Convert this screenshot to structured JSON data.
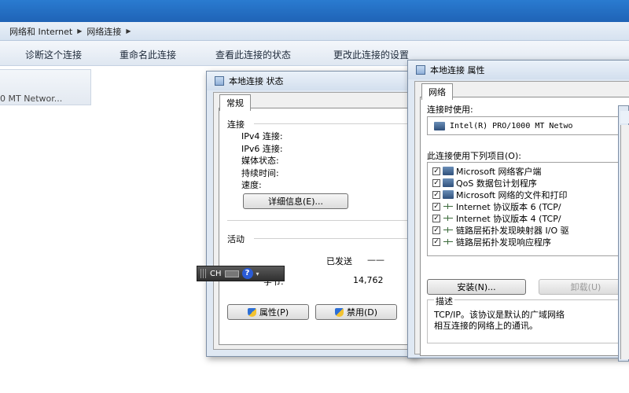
{
  "breadcrumb": {
    "items": [
      "网络和 Internet",
      "网络连接"
    ]
  },
  "toolbar": {
    "items": [
      "诊断这个连接",
      "重命名此连接",
      "查看此连接的状态",
      "更改此连接的设置"
    ]
  },
  "adapter": {
    "label": "0 MT Networ..."
  },
  "status_dialog": {
    "title": "本地连接 状态",
    "tab": "常规",
    "connection_section": "连接",
    "fields": [
      "IPv4 连接:",
      "IPv6 连接:",
      "媒体状态:",
      "持续时间:",
      "速度:"
    ],
    "details_button": "详细信息(E)...",
    "activity_section": "活动",
    "sent_label": "已发送",
    "sent_dash": "——",
    "bytes_label": "字节:",
    "bytes_sent": "14,762",
    "properties_button": "属性(P)",
    "disable_button": "禁用(D)"
  },
  "properties_dialog": {
    "title": "本地连接 属性",
    "tab": "网络",
    "connect_using_label": "连接时使用:",
    "adapter_name": "Intel(R) PRO/1000 MT Netwo",
    "items_label": "此连接使用下列项目(O):",
    "items": [
      {
        "label": "Microsoft 网络客户端",
        "icon": "network-client-icon"
      },
      {
        "label": "QoS 数据包计划程序",
        "icon": "qos-icon"
      },
      {
        "label": "Microsoft 网络的文件和打印",
        "icon": "file-share-icon"
      },
      {
        "label": "Internet 协议版本 6 (TCP/",
        "icon": "protocol-icon"
      },
      {
        "label": "Internet 协议版本 4 (TCP/",
        "icon": "protocol-icon"
      },
      {
        "label": "链路层拓扑发现映射器 I/O 驱",
        "icon": "protocol-icon"
      },
      {
        "label": "链路层拓扑发现响应程序",
        "icon": "protocol-icon"
      }
    ],
    "install_button": "安装(N)...",
    "uninstall_button": "卸载(U)",
    "description_label": "描述",
    "description_text": "TCP/IP。该协议是默认的广域网络",
    "description_text2": "相互连接的网络上的通讯。"
  },
  "langbar": {
    "lang": "CH",
    "help": "?"
  }
}
